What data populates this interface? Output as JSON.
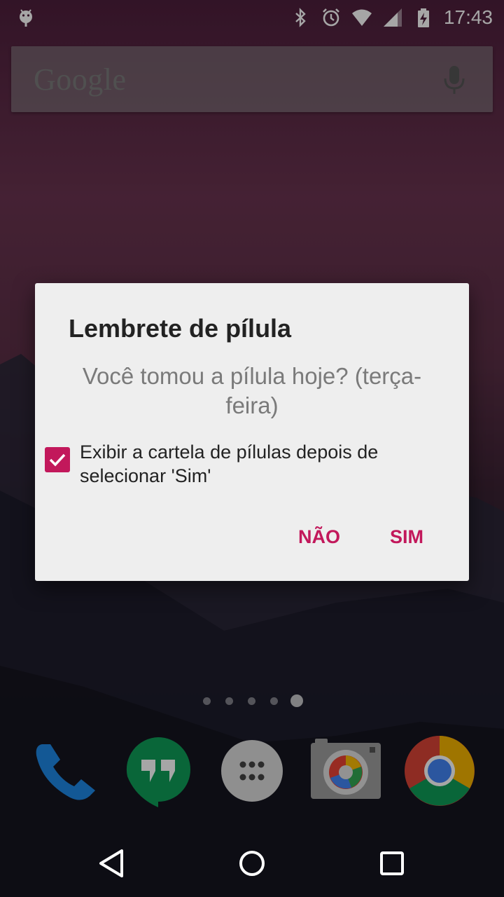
{
  "status_bar": {
    "time": "17:43",
    "icons": [
      "android-icon",
      "bluetooth-icon",
      "alarm-icon",
      "wifi-icon",
      "signal-icon",
      "battery-charging-icon"
    ]
  },
  "search_widget": {
    "logo_text": "Google",
    "icon": "mic-icon"
  },
  "dialog": {
    "title": "Lembrete de pílula",
    "message": "Você tomou a pílula hoje? (terça-feira)",
    "checkbox_label": "Exibir a cartela de pílulas depois de selecionar 'Sim'",
    "checkbox_checked": true,
    "negative_button": "NÃO",
    "positive_button": "SIM",
    "accent_color": "#c2185b"
  },
  "home_screen": {
    "page_count": 5,
    "active_page": 5,
    "dock": [
      "phone-icon",
      "hangouts-icon",
      "app-drawer-icon",
      "camera-icon",
      "chrome-icon"
    ]
  },
  "nav_bar": {
    "buttons": [
      "back-icon",
      "home-icon",
      "recents-icon"
    ]
  }
}
